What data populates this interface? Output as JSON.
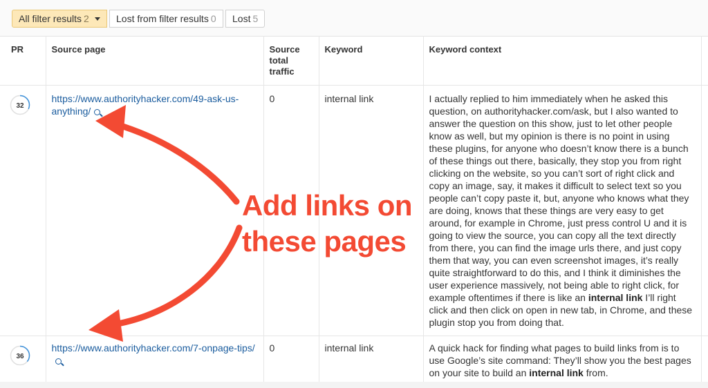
{
  "filters": [
    {
      "label": "All filter results",
      "count": "2",
      "active": true
    },
    {
      "label": "Lost from filter results",
      "count": "0",
      "active": false
    },
    {
      "label": "Lost",
      "count": "5",
      "active": false
    }
  ],
  "table": {
    "headers": {
      "pr": "PR",
      "source_page": "Source page",
      "source_total_traffic": "Source total traffic",
      "keyword": "Keyword",
      "keyword_context": "Keyword context"
    },
    "rows": [
      {
        "pr": "32",
        "source_url": "https://www.authorityhacker.com/49-ask-us-anything/",
        "traffic": "0",
        "keyword": "internal link",
        "context_before": "I actually replied to him immediately when he asked this question, on authorityhacker.com/ask, but I also wanted to answer the question on this show, just to let other people know as well, but my opinion is there is no point in using these plugins, for anyone who doesn’t know there is a bunch of these things out there, basically, they stop you from right clicking on the website, so you can’t sort of right click and copy an image, say, it makes it difficult to select text so you people can’t copy paste it, but, anyone who knows what they are doing, knows that these things are very easy to get around, for example in Chrome, just press control U and it is going to view the source, you can copy all the text directly from there, you can find the image urls there, and just copy them that way, you can even screenshot images, it’s really quite straightforward to do this, and I think it diminishes the user experience massively, not being able to right click, for example oftentimes if there is like an ",
        "context_keyword": "internal link",
        "context_after": " I’ll right click and then click on open in new tab, in Chrome, and these plugin stop you from doing that."
      },
      {
        "pr": "36",
        "source_url": "https://www.authorityhacker.com/7-onpage-tips/",
        "traffic": "0",
        "keyword": "internal link",
        "context_before": "A quick hack for finding what pages to build links from is to use Google’s site command: They’ll show you the best pages on your site to build an ",
        "context_keyword": "internal link",
        "context_after": " from."
      }
    ]
  },
  "annotation": {
    "line1": "Add links on",
    "line2": "these pages",
    "color": "#f34a33"
  },
  "colors": {
    "active_filter_bg": "#fde8b8",
    "link": "#1a5c9e",
    "pr_ring_track": "#e0e0e0",
    "pr_ring_fill": "#3b8fd9"
  }
}
